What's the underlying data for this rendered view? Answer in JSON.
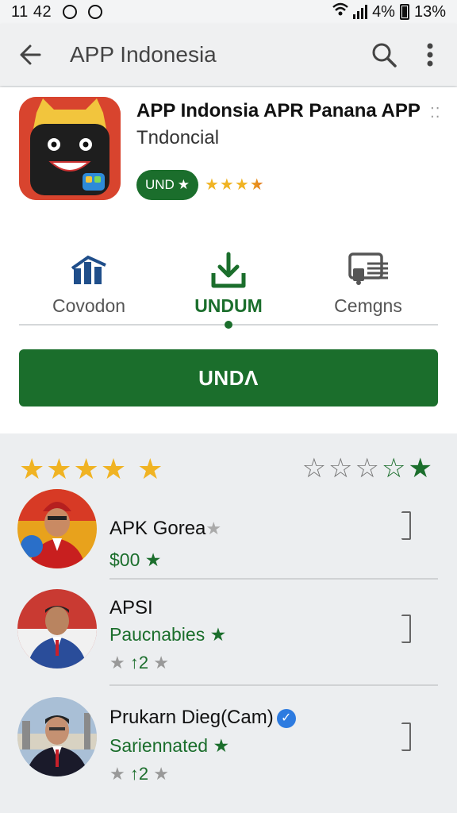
{
  "status_bar": {
    "time": "11 42",
    "signal": "4%",
    "battery": "13%"
  },
  "app_bar": {
    "title": "APP Indonesia"
  },
  "app": {
    "name": "APP Indonsia APR Panana APP",
    "subtitle": "Tndoncial",
    "badge_label": "UND",
    "badge_star": "★",
    "rating_stars": "★★★★",
    "overflow_dots": "⁚⁚"
  },
  "tabs": [
    {
      "label": "Covodon",
      "icon": "chart-bars-icon"
    },
    {
      "label": "UNDUM",
      "icon": "download-icon"
    },
    {
      "label": "Cemgns",
      "icon": "printer-icon"
    }
  ],
  "install_button": {
    "label": "UNDΛ"
  },
  "reviews_header": {
    "left_stars": "★★★★ ★",
    "right_outline_stars": "☆☆☆",
    "right_green_outline_star": "☆",
    "right_green_star": "★"
  },
  "reviews": [
    {
      "name": "APK Gorea",
      "name_suffix": "★",
      "subtitle": "$00",
      "subtitle_star": "★",
      "meta": ""
    },
    {
      "name": "APSI",
      "name_suffix": "",
      "subtitle": "Paucnabies",
      "subtitle_star": "★",
      "meta_left": "★",
      "meta_mid": "↑2",
      "meta_right": "★"
    },
    {
      "name": "Prukarn Dieg(Cam)",
      "name_suffix": "",
      "verified": "✓",
      "subtitle": "Sariennated",
      "subtitle_star": "★",
      "meta_left": "★",
      "meta_mid": "↑2",
      "meta_right": "★"
    }
  ],
  "colors": {
    "primary_green": "#1b6e2c",
    "star_gold": "#f0b323",
    "icon_red": "#d8442e",
    "verified_blue": "#2d7be0"
  }
}
